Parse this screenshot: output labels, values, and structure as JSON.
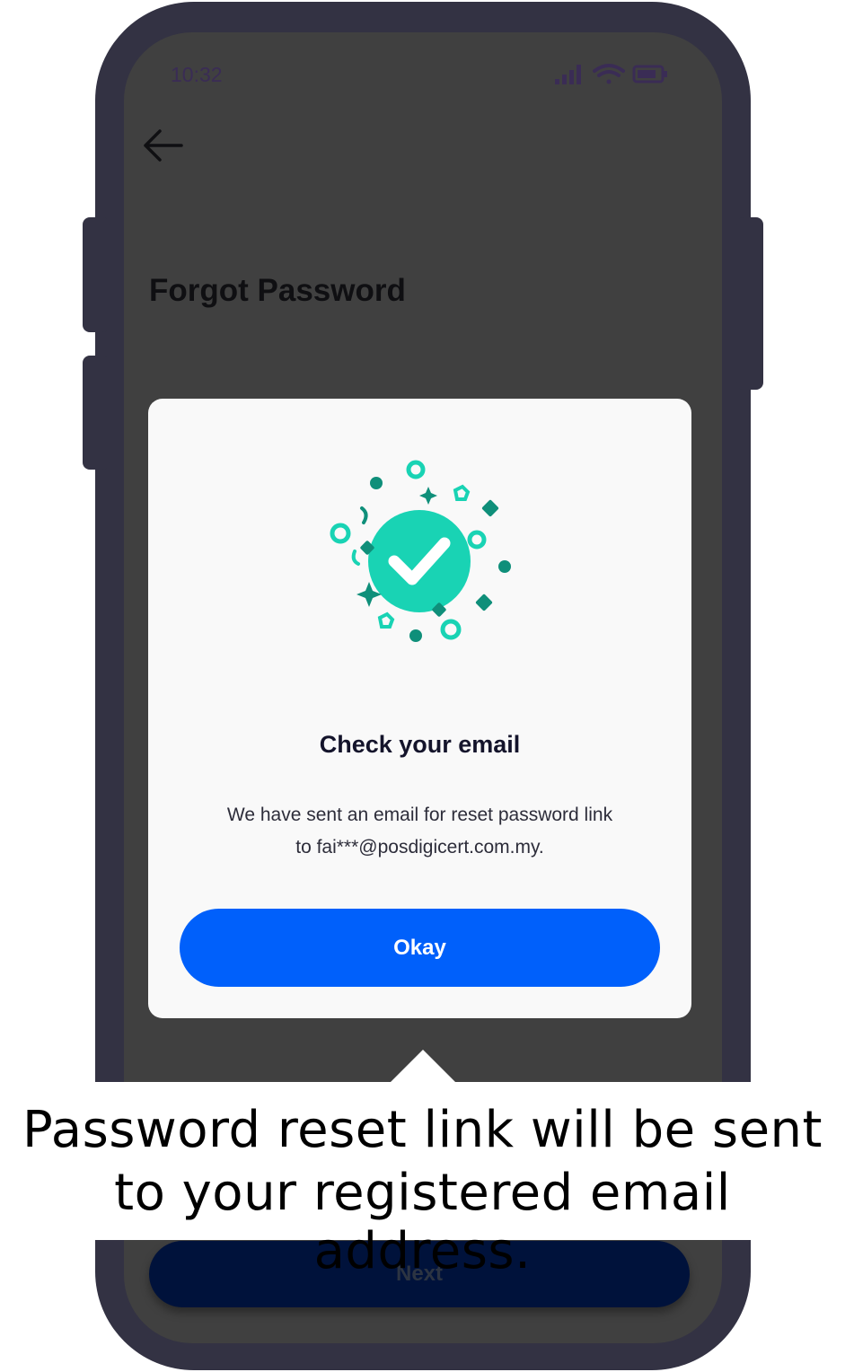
{
  "status_bar": {
    "time": "10:32",
    "icons": [
      "signal-icon",
      "wifi-icon",
      "battery-icon"
    ]
  },
  "screen": {
    "back_icon": "arrow-left-icon",
    "title": "Forgot Password",
    "next_label": "Next"
  },
  "dialog": {
    "illustration": "success-check-confetti-icon",
    "title": "Check your email",
    "message_line1": "We have sent an email for reset password link",
    "message_line2": "to fai***@posdigicert.com.my.",
    "okay_label": "Okay"
  },
  "caption": {
    "line1": "Password reset link will be sent",
    "line2": "to your registered email address."
  },
  "colors": {
    "phone_frame": "#333243",
    "overlay": "#404040",
    "primary_button": "#0060fb",
    "next_button": "#00123b",
    "accent_teal": "#19d3b4",
    "accent_dark_teal": "#0f8f7a"
  }
}
